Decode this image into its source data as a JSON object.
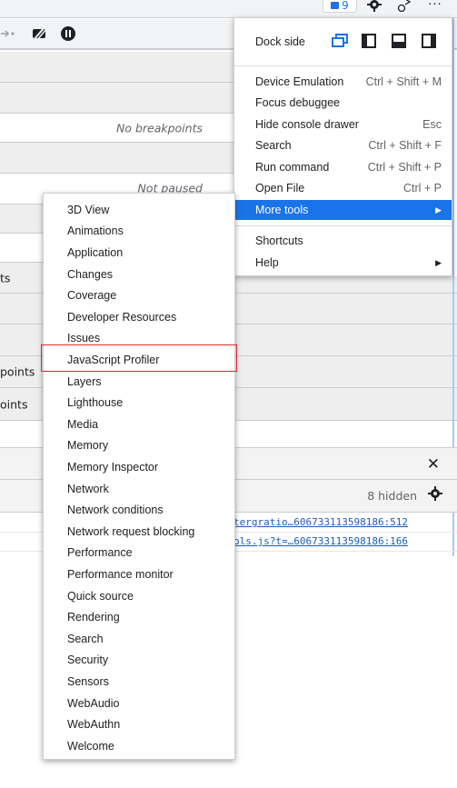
{
  "topbar": {
    "issues_count": "9",
    "icons": [
      "issues-flag-icon",
      "settings-gear-icon",
      "feedback-icon",
      "more-options-icon"
    ]
  },
  "debugger_toolbar": {
    "icons": [
      "step-icon",
      "deactivate-breakpoints-icon",
      "pause-on-exceptions-icon"
    ]
  },
  "panes": {
    "breakpoints_note": "No breakpoints",
    "callstack_note": "Not paused",
    "cut_labels": [
      "ts",
      "points",
      "oints"
    ]
  },
  "main_menu": {
    "dock_side_label": "Dock side",
    "dock_options": [
      "undock-icon",
      "dock-left-icon",
      "dock-bottom-icon",
      "dock-right-icon"
    ],
    "items": [
      {
        "label": "Device Emulation",
        "shortcut": "Ctrl + Shift + M"
      },
      {
        "label": "Focus debuggee",
        "shortcut": ""
      },
      {
        "label": "Hide console drawer",
        "shortcut": "Esc"
      },
      {
        "label": "Search",
        "shortcut": "Ctrl + Shift + F"
      },
      {
        "label": "Run command",
        "shortcut": "Ctrl + Shift + P"
      },
      {
        "label": "Open File",
        "shortcut": "Ctrl + P"
      },
      {
        "label": "More tools",
        "shortcut": "",
        "submenu": true,
        "active": true
      }
    ],
    "items2": [
      {
        "label": "Shortcuts"
      },
      {
        "label": "Help",
        "submenu": true
      }
    ]
  },
  "more_tools_submenu": {
    "items": [
      "3D View",
      "Animations",
      "Application",
      "Changes",
      "Coverage",
      "Developer Resources",
      "Issues",
      "JavaScript Profiler",
      "Layers",
      "Lighthouse",
      "Media",
      "Memory",
      "Memory Inspector",
      "Network",
      "Network conditions",
      "Network request blocking",
      "Performance",
      "Performance monitor",
      "Quick source",
      "Rendering",
      "Search",
      "Security",
      "Sensors",
      "WebAudio",
      "WebAuthn",
      "Welcome"
    ],
    "highlighted": "JavaScript Profiler"
  },
  "console": {
    "hidden_label": "8 hidden",
    "links": [
      "tergratio…606733113598186:512",
      "ols.js?t=…606733113598186:166"
    ]
  },
  "colors": {
    "accent": "#1a73e8",
    "highlight_border": "#d92b2b"
  }
}
